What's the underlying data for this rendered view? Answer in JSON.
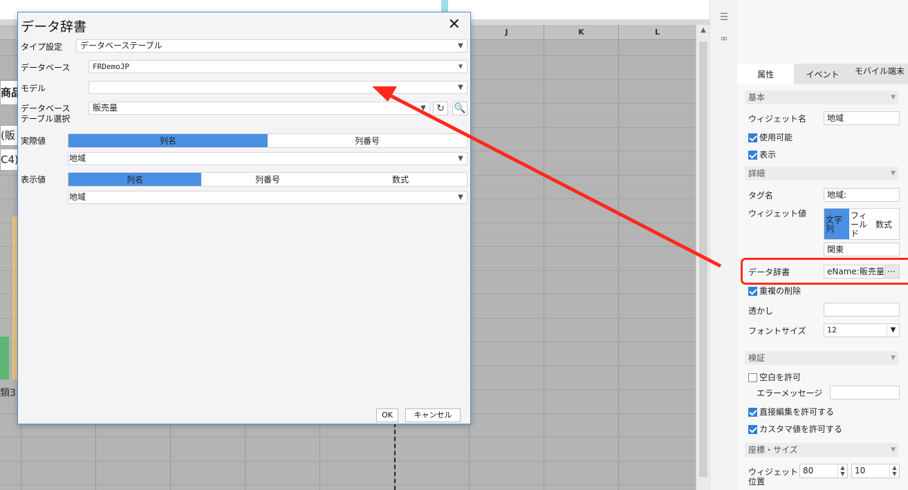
{
  "sheet": {
    "columns": [
      "J",
      "K",
      "L"
    ],
    "left_fragments": [
      "商品",
      "(販",
      "C4)"
    ],
    "axis_fragment": "類3"
  },
  "dialog": {
    "title": "データ辞書",
    "close_glyph": "✕",
    "type_label": "タイプ設定",
    "type_value": "データベーステーブル",
    "database_label": "データベース",
    "database_value": "FRDemoJP",
    "model_label": "モデル",
    "model_value": "",
    "table_label_line1": "データベース",
    "table_label_line2": "テーブル選択",
    "table_value": "販売量",
    "actual_label": "実際値",
    "actual_segments": [
      "列名",
      "列番号"
    ],
    "actual_selected": "列名",
    "actual_value": "地域",
    "display_label": "表示値",
    "display_segments": [
      "列名",
      "列番号",
      "数式"
    ],
    "display_selected": "列名",
    "display_value": "地域",
    "ok_label": "OK",
    "cancel_label": "キャンセル"
  },
  "panel": {
    "tabs": [
      "属性",
      "イベント",
      "モバイル端末"
    ],
    "active_tab": "属性",
    "sections": {
      "basic": "基本",
      "detail": "詳細",
      "validation": "検証",
      "coords": "座標・サイズ"
    },
    "widget_name_label": "ウィジェット名",
    "widget_name_value": "地域",
    "enabled_label": "使用可能",
    "visible_label": "表示",
    "tag_label": "タグ名",
    "tag_value": "地域:",
    "widget_value_label": "ウィジェット値",
    "widget_value_types": [
      "文字列",
      "フィールド",
      "数式"
    ],
    "widget_value_selected": "文字列",
    "widget_value_text": "関東",
    "data_dict_label": "データ辞書",
    "data_dict_value": "eName:販売量]",
    "data_dict_button": "···",
    "remove_dup_label": "重複の削除",
    "watermark_label": "透かし",
    "watermark_value": "",
    "font_size_label": "フォントサイズ",
    "font_size_value": "12",
    "allow_blank_label": "空白を許可",
    "error_msg_label": "エラーメッセージ",
    "error_msg_value": "",
    "direct_edit_label": "直接編集を許可する",
    "custom_value_label": "カスタマ値を許可する",
    "position_label_line1": "ウィジェット",
    "position_label_line2": "位置",
    "pos_x": "80",
    "pos_y": "10"
  },
  "colors": {
    "accent": "#4a90e2",
    "highlight_red": "#ff2a1a",
    "grid_gray": "#b4b4b4"
  }
}
